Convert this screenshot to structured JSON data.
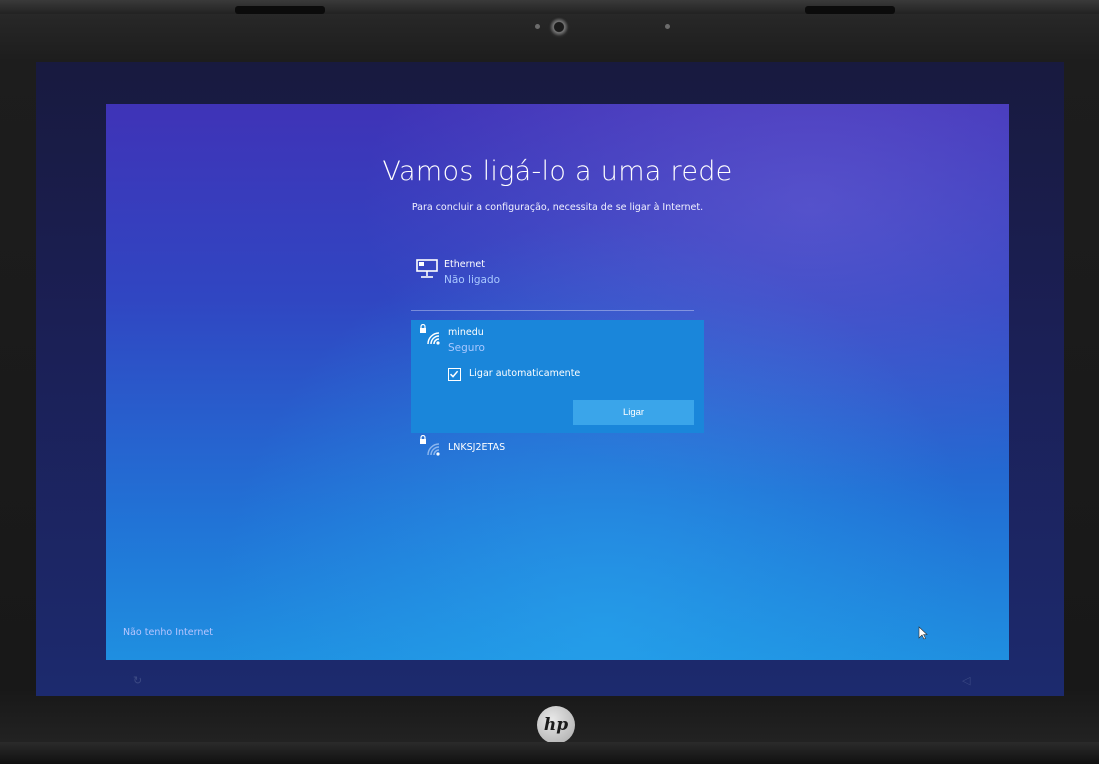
{
  "screen": {
    "title": "Vamos ligá-lo a uma rede",
    "subtitle": "Para concluir a configuração, necessita de se ligar à Internet."
  },
  "networks": [
    {
      "name": "Ethernet",
      "status": "Não ligado",
      "icon": "ethernet-icon"
    },
    {
      "name": "minedu",
      "status": "Seguro",
      "icon": "wifi-secured-icon",
      "auto_connect_label": "Ligar automaticamente",
      "auto_connect_checked": true,
      "connect_label": "Ligar"
    },
    {
      "name": "LNKSJ2ETAS",
      "icon": "wifi-secured-icon"
    }
  ],
  "footer": {
    "no_internet": "Não tenho Internet"
  },
  "device": {
    "brand_logo": "hp"
  },
  "colors": {
    "selected_item": "#1a86da",
    "button": "#3aa5ea",
    "status_text": "#a9c8ff"
  }
}
